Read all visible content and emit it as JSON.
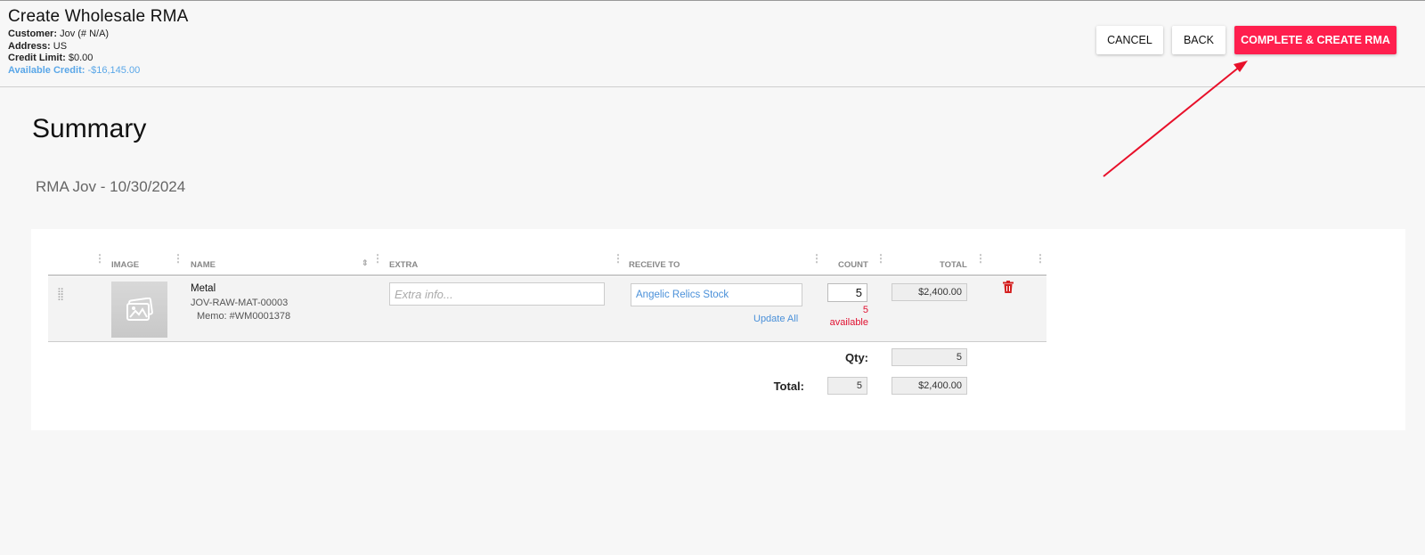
{
  "header": {
    "title": "Create Wholesale RMA",
    "customer_label": "Customer:",
    "customer_value": "Jov (# N/A)",
    "address_label": "Address:",
    "address_value": "US",
    "credit_limit_label": "Credit Limit:",
    "credit_limit_value": "$0.00",
    "available_credit_label": "Available Credit:",
    "available_credit_value": "-$16,145.00"
  },
  "actions": {
    "cancel_label": "CANCEL",
    "back_label": "BACK",
    "complete_label": "COMPLETE & CREATE RMA"
  },
  "summary": {
    "title": "Summary",
    "rma_name": "RMA Jov - 10/30/2024"
  },
  "table": {
    "columns": [
      "IMAGE",
      "NAME",
      "EXTRA",
      "RECEIVE TO",
      "COUNT",
      "TOTAL"
    ],
    "rows": [
      {
        "name": "Metal",
        "sku": "JOV-RAW-MAT-00003",
        "memo": "Memo: #WM0001378",
        "extra_placeholder": "Extra info...",
        "receive_to": "Angelic Relics Stock",
        "update_all": "Update All",
        "count": "5",
        "available_count": "5",
        "available_label": "available",
        "total": "$2,400.00"
      }
    ]
  },
  "totals": {
    "qty_label": "Qty:",
    "qty_value": "5",
    "total_label": "Total:",
    "total_count": "5",
    "total_value": "$2,400.00"
  },
  "colors": {
    "primary": "#ff1f4e",
    "link": "#4a90d9",
    "credit": "#5aa7e8",
    "alert": "#e01030"
  }
}
